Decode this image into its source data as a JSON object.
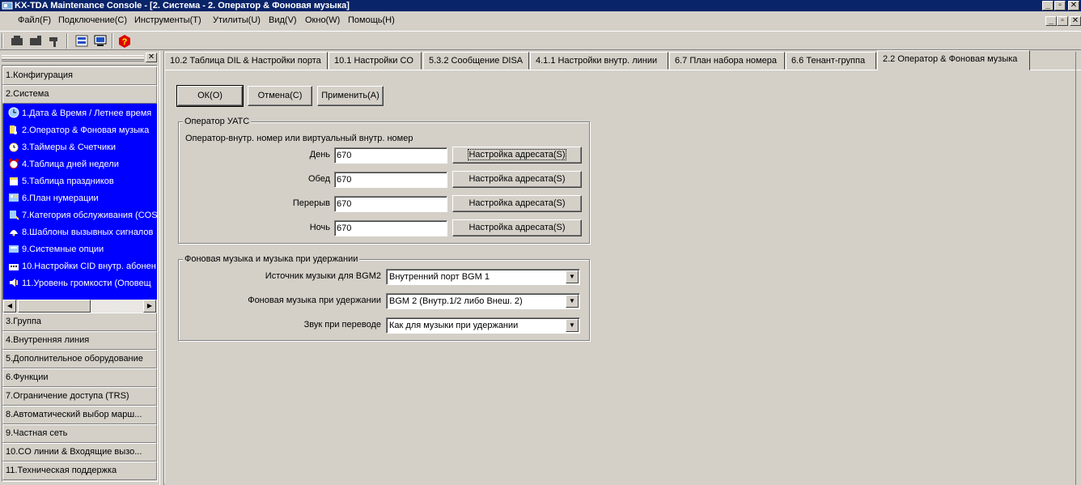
{
  "window": {
    "title": "KX-TDA Maintenance Console - [2. Система - 2. Оператор & Фоновая музыка]",
    "minimize_glyph": "_",
    "restore_glyph": "▫",
    "close_glyph": "✕"
  },
  "menu": {
    "items": [
      {
        "label": "Файл(F)"
      },
      {
        "label": "Подключение(C)"
      },
      {
        "label": "Инструменты(T)"
      },
      {
        "label": "Утилиты(U)"
      },
      {
        "label": "Вид(V)"
      },
      {
        "label": "Окно(W)"
      },
      {
        "label": "Помощь(H)"
      }
    ]
  },
  "toolbar": {
    "icons": [
      "connect-icon",
      "disconnect-icon",
      "hammer-icon",
      "database-icon",
      "screen-icon",
      "help-icon"
    ]
  },
  "left_pane": {
    "close_glyph": "✕",
    "categories_top": [
      {
        "label": "1.Конфигурация"
      },
      {
        "label": "2.Система"
      }
    ],
    "system_items": [
      {
        "label": "1.Дата & Время / Летнее время",
        "icon": "clock-globe-icon"
      },
      {
        "label": "2.Оператор & Фоновая музыка",
        "icon": "operator-music-icon"
      },
      {
        "label": "3.Таймеры & Счетчики",
        "icon": "timer-icon"
      },
      {
        "label": "4.Таблица дней недели",
        "icon": "alarm-clock-icon"
      },
      {
        "label": "5.Таблица праздников",
        "icon": "holiday-icon"
      },
      {
        "label": "6.План нумерации",
        "icon": "numbering-icon"
      },
      {
        "label": "7.Категория обслуживания (COS",
        "icon": "cos-icon"
      },
      {
        "label": "8.Шаблоны вызывных сигналов",
        "icon": "ring-pattern-icon"
      },
      {
        "label": "9.Системные опции",
        "icon": "system-options-icon"
      },
      {
        "label": "10.Настройки CID внутр. абонен",
        "icon": "cid-icon"
      },
      {
        "label": "11.Уровень громкости (Оповещ",
        "icon": "volume-icon"
      }
    ],
    "scroll_left_glyph": "◀",
    "scroll_right_glyph": "▶",
    "categories_bottom": [
      {
        "label": "3.Группа"
      },
      {
        "label": "4.Внутренняя линия"
      },
      {
        "label": "5.Дополнительное оборудование"
      },
      {
        "label": "6.Функции"
      },
      {
        "label": "7.Ограничение доступа (TRS)"
      },
      {
        "label": "8.Автоматический выбор марш..."
      },
      {
        "label": "9.Частная сеть"
      },
      {
        "label": "10.CO линии & Входящие вызо..."
      },
      {
        "label": "11.Техническая поддержка"
      }
    ]
  },
  "tabs": [
    {
      "label": "10.2 Таблица DIL & Настройки порта"
    },
    {
      "label": "10.1 Настройки CO"
    },
    {
      "label": "5.3.2 Сообщение DISA"
    },
    {
      "label": "4.1.1 Настройки внутр. линии"
    },
    {
      "label": "6.7 План набора номера"
    },
    {
      "label": "6.6 Тенант-группа"
    },
    {
      "label": "2.2 Оператор & Фоновая музыка"
    }
  ],
  "actions": {
    "ok": "ОК(O)",
    "cancel": "Отмена(C)",
    "apply": "Применить(A)"
  },
  "operator_group": {
    "title": "Оператор УАТС",
    "subtitle": "Оператор-внутр. номер или виртуальный внутр. номер",
    "rows": [
      {
        "label": "День",
        "value": "670",
        "button": "Настройка адресата(S)"
      },
      {
        "label": "Обед",
        "value": "670",
        "button": "Настройка адресата(S)"
      },
      {
        "label": "Перерыв",
        "value": "670",
        "button": "Настройка адресата(S)"
      },
      {
        "label": "Ночь",
        "value": "670",
        "button": "Настройка адресата(S)"
      }
    ]
  },
  "music_group": {
    "title": "Фоновая музыка и музыка при удержании",
    "dropdown_glyph": "▼",
    "rows": [
      {
        "label": "Источник музыки для BGM2",
        "value": "Внутренний порт BGM 1"
      },
      {
        "label": "Фоновая музыка при удержании",
        "value": "BGM 2 (Внутр.1/2 либо Внеш. 2)"
      },
      {
        "label": "Звук при переводе",
        "value": "Как для музыки при удержании"
      }
    ]
  }
}
